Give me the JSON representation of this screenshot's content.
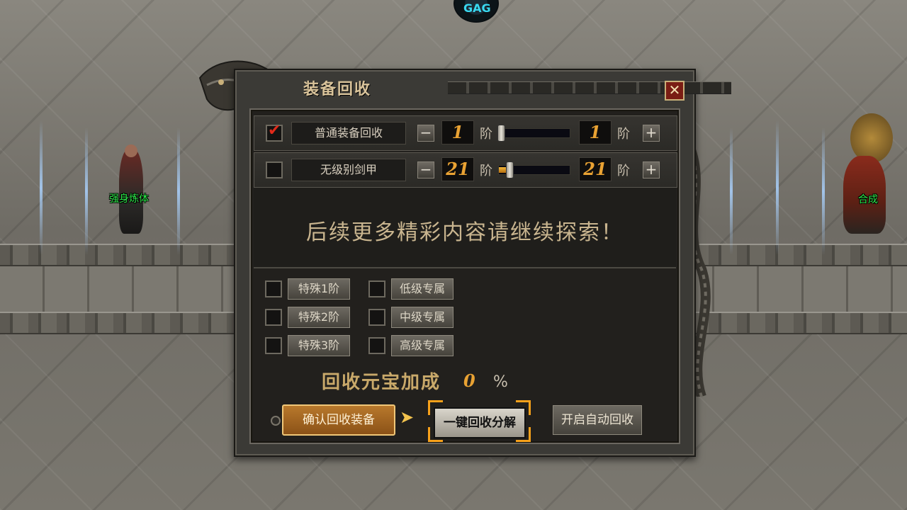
{
  "scene": {
    "npc_left_name": "强身炼体",
    "npc_right_name": "合成"
  },
  "panel": {
    "title": "装备回收",
    "close_label": "✕",
    "rows": [
      {
        "checked": true,
        "label": "普通装备回收",
        "min_value": "1",
        "max_value": "1",
        "unit": "阶",
        "slider_fill": 0.0
      },
      {
        "checked": false,
        "label": "无级别剑甲",
        "min_value": "21",
        "max_value": "21",
        "unit": "阶",
        "slider_fill": 0.1
      }
    ],
    "minus_label": "−",
    "plus_label": "+",
    "promo_text": "后续更多精彩内容请继续探索！",
    "options_left": [
      "特殊1阶",
      "特殊2阶",
      "特殊3阶"
    ],
    "options_right": [
      "低级专属",
      "中级专属",
      "高级专属"
    ],
    "bonus_label": "回收元宝加成",
    "bonus_value": "0",
    "bonus_unit": "%",
    "confirm_label": "确认回收装备",
    "oneclick_label": "一键回收分解",
    "auto_label": "开启自动回收"
  },
  "colors": {
    "accent_orange": "#f7a11a",
    "value_gold": "#e9a233",
    "npc_name_green": "#2ee84a"
  }
}
